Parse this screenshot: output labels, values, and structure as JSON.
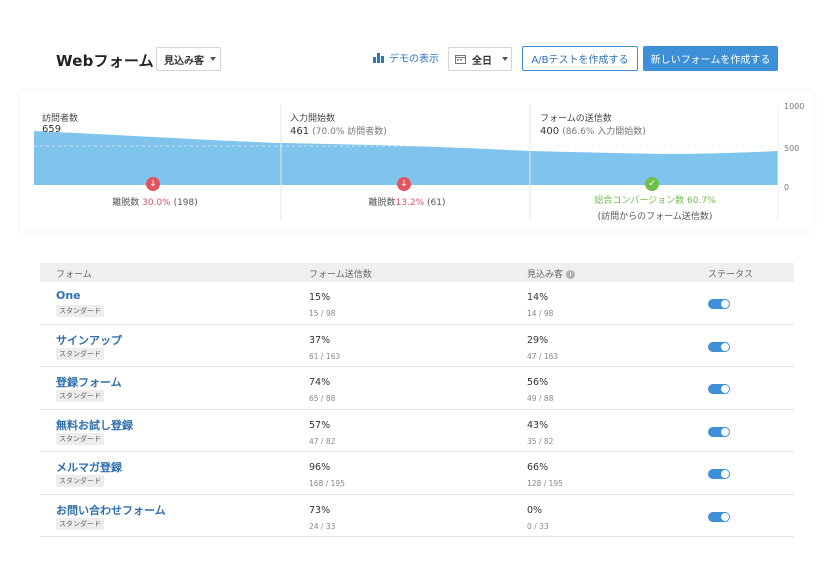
{
  "header": {
    "title": "Webフォーム",
    "segment": "見込み客",
    "demo_label": "デモの表示",
    "period": "全日",
    "ab_button": "A/Bテストを作成する",
    "new_button": "新しいフォームを作成する"
  },
  "funnel": {
    "y_ticks": [
      "1000",
      "500",
      "0"
    ],
    "columns": [
      {
        "label": "訪問者数",
        "value": "659",
        "sub": ""
      },
      {
        "label": "入力開始数",
        "value": "461",
        "sub": "(70.0% 訪問者数)"
      },
      {
        "label": "フォームの送信数",
        "value": "400",
        "sub": "(86.6% 入力開始数)"
      }
    ],
    "drops": [
      {
        "prefix": "離脱数 ",
        "pct": "30.0%",
        "count": "(198)"
      },
      {
        "prefix": "離脱数",
        "pct": "13.2%",
        "count": "(61)"
      }
    ],
    "conversion": {
      "line1": "総合コンバージョン数 60.7%",
      "line2": "(訪問からのフォーム送信数)"
    }
  },
  "table": {
    "headers": {
      "form": "フォーム",
      "submits": "フォーム送信数",
      "leads": "見込み客",
      "status": "ステータス"
    },
    "badge": "スタンダード",
    "rows": [
      {
        "name": "One",
        "sub_pct": "15%",
        "sub_ratio": "15 / 98",
        "lead_pct": "14%",
        "lead_ratio": "14 / 98",
        "enabled": true
      },
      {
        "name": "サインアップ",
        "sub_pct": "37%",
        "sub_ratio": "61 / 163",
        "lead_pct": "29%",
        "lead_ratio": "47 / 163",
        "enabled": true
      },
      {
        "name": "登録フォーム",
        "sub_pct": "74%",
        "sub_ratio": "65 / 88",
        "lead_pct": "56%",
        "lead_ratio": "49 / 88",
        "enabled": true
      },
      {
        "name": "無料お試し登録",
        "sub_pct": "57%",
        "sub_ratio": "47 / 82",
        "lead_pct": "43%",
        "lead_ratio": "35 / 82",
        "enabled": true
      },
      {
        "name": "メルマガ登録",
        "sub_pct": "96%",
        "sub_ratio": "168 / 195",
        "lead_pct": "66%",
        "lead_ratio": "128 / 195",
        "enabled": true
      },
      {
        "name": "お問い合わせフォーム",
        "sub_pct": "73%",
        "sub_ratio": "24 / 33",
        "lead_pct": "0%",
        "lead_ratio": "0 / 33",
        "enabled": true
      }
    ]
  },
  "colors": {
    "accent": "#3d8fd8",
    "funnel_fill": "#7fc4ec",
    "drop_red": "#e0555f",
    "success_green": "#6fbf4b"
  }
}
